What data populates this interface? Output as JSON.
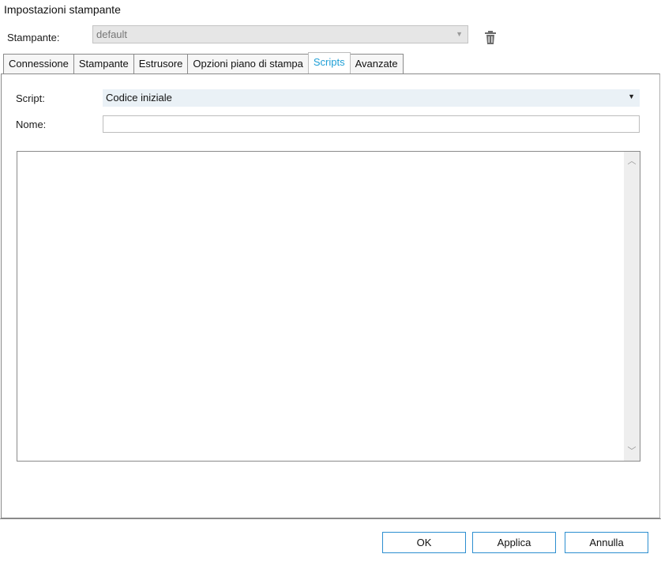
{
  "window": {
    "title": "Impostazioni stampante"
  },
  "printer": {
    "label": "Stampante:",
    "value": "default"
  },
  "icons": {
    "trash": "trash-icon",
    "dropdown": "chevron-down-icon",
    "scroll_up": "chevron-up-icon",
    "scroll_down": "chevron-down-icon"
  },
  "tabs": [
    {
      "label": "Connessione",
      "active": false
    },
    {
      "label": "Stampante",
      "active": false
    },
    {
      "label": "Estrusore",
      "active": false
    },
    {
      "label": "Opzioni piano di stampa",
      "active": false
    },
    {
      "label": "Scripts",
      "active": true
    },
    {
      "label": "Avanzate",
      "active": false
    }
  ],
  "scripts_tab": {
    "script_label": "Script:",
    "script_value": "Codice iniziale",
    "name_label": "Nome:",
    "name_value": "",
    "editor_content": ""
  },
  "buttons": {
    "ok": "OK",
    "apply": "Applica",
    "cancel": "Annulla"
  },
  "colors": {
    "accent": "#1e9fd6",
    "button_border": "#2c8ed0",
    "select_bg": "#eaf1f6"
  }
}
